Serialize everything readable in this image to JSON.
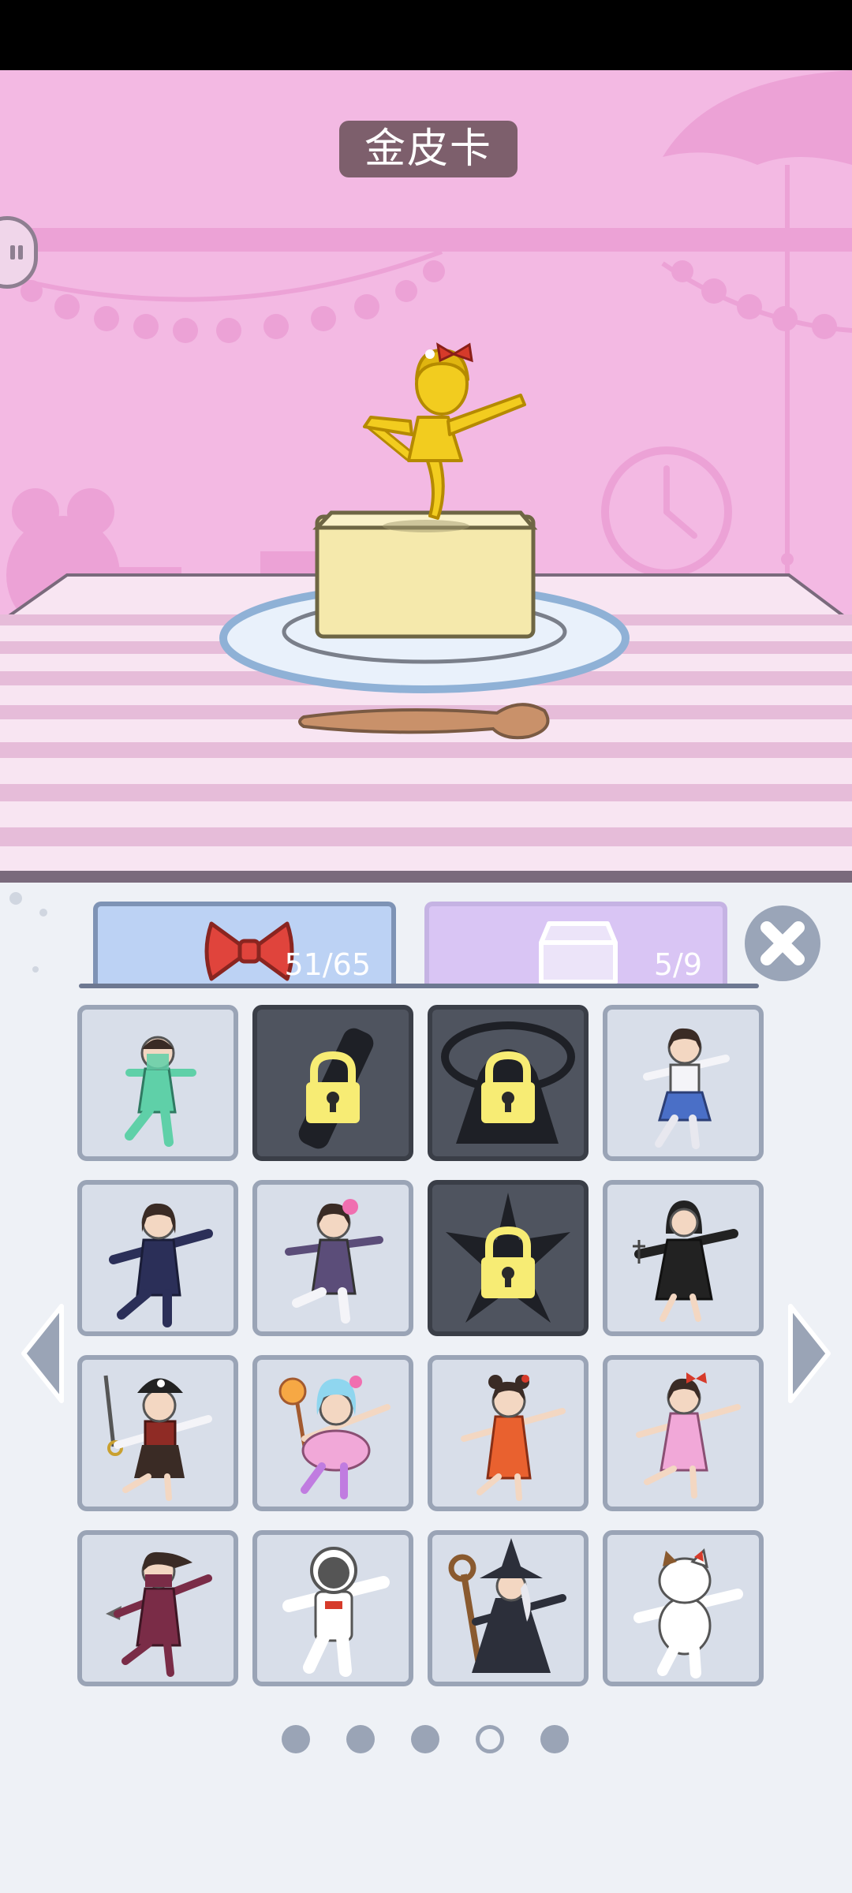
{
  "header": {
    "title": "金皮卡"
  },
  "tabs": [
    {
      "icon": "bow-icon",
      "count": "51/65",
      "selected": true
    },
    {
      "icon": "box-icon",
      "count": "5/9",
      "selected": false
    }
  ],
  "colors": {
    "scene_bg": "#f3b9e3",
    "panel_bg": "#eef1f6",
    "tab_outfits": "#bcd2f4",
    "tab_boxes": "#d9c5f4",
    "cell_unlocked": "#d8dee9",
    "cell_locked": "#4f545f"
  },
  "costumes": [
    {
      "name": "genie-costume",
      "locked": false,
      "color": "#5fd0a8"
    },
    {
      "name": "locked-scroll",
      "locked": true
    },
    {
      "name": "locked-bride",
      "locked": true
    },
    {
      "name": "schoolgirl-costume",
      "locked": false,
      "color": "#4a6fc7"
    },
    {
      "name": "japanese-uniform",
      "locked": false,
      "color": "#2b2f58"
    },
    {
      "name": "flower-girl-costume",
      "locked": false,
      "color": "#5b4d79"
    },
    {
      "name": "locked-battleship",
      "locked": true
    },
    {
      "name": "nun-costume",
      "locked": false,
      "color": "#222"
    },
    {
      "name": "pirate-costume",
      "locked": false,
      "color": "#8f2b25"
    },
    {
      "name": "candy-costume",
      "locked": false,
      "color": "#e6a0c4"
    },
    {
      "name": "qipao-costume",
      "locked": false,
      "color": "#e9612f"
    },
    {
      "name": "pink-dress-costume",
      "locked": false,
      "color": "#f1a8d8"
    },
    {
      "name": "ninja-costume",
      "locked": false,
      "color": "#7a2c47"
    },
    {
      "name": "astronaut-costume",
      "locked": false,
      "color": "#ffffff"
    },
    {
      "name": "witch-costume",
      "locked": false,
      "color": "#2c2f3a"
    },
    {
      "name": "cat-costume",
      "locked": false,
      "color": "#ffffff"
    }
  ],
  "pagination": {
    "pages": 5,
    "current": 4
  }
}
